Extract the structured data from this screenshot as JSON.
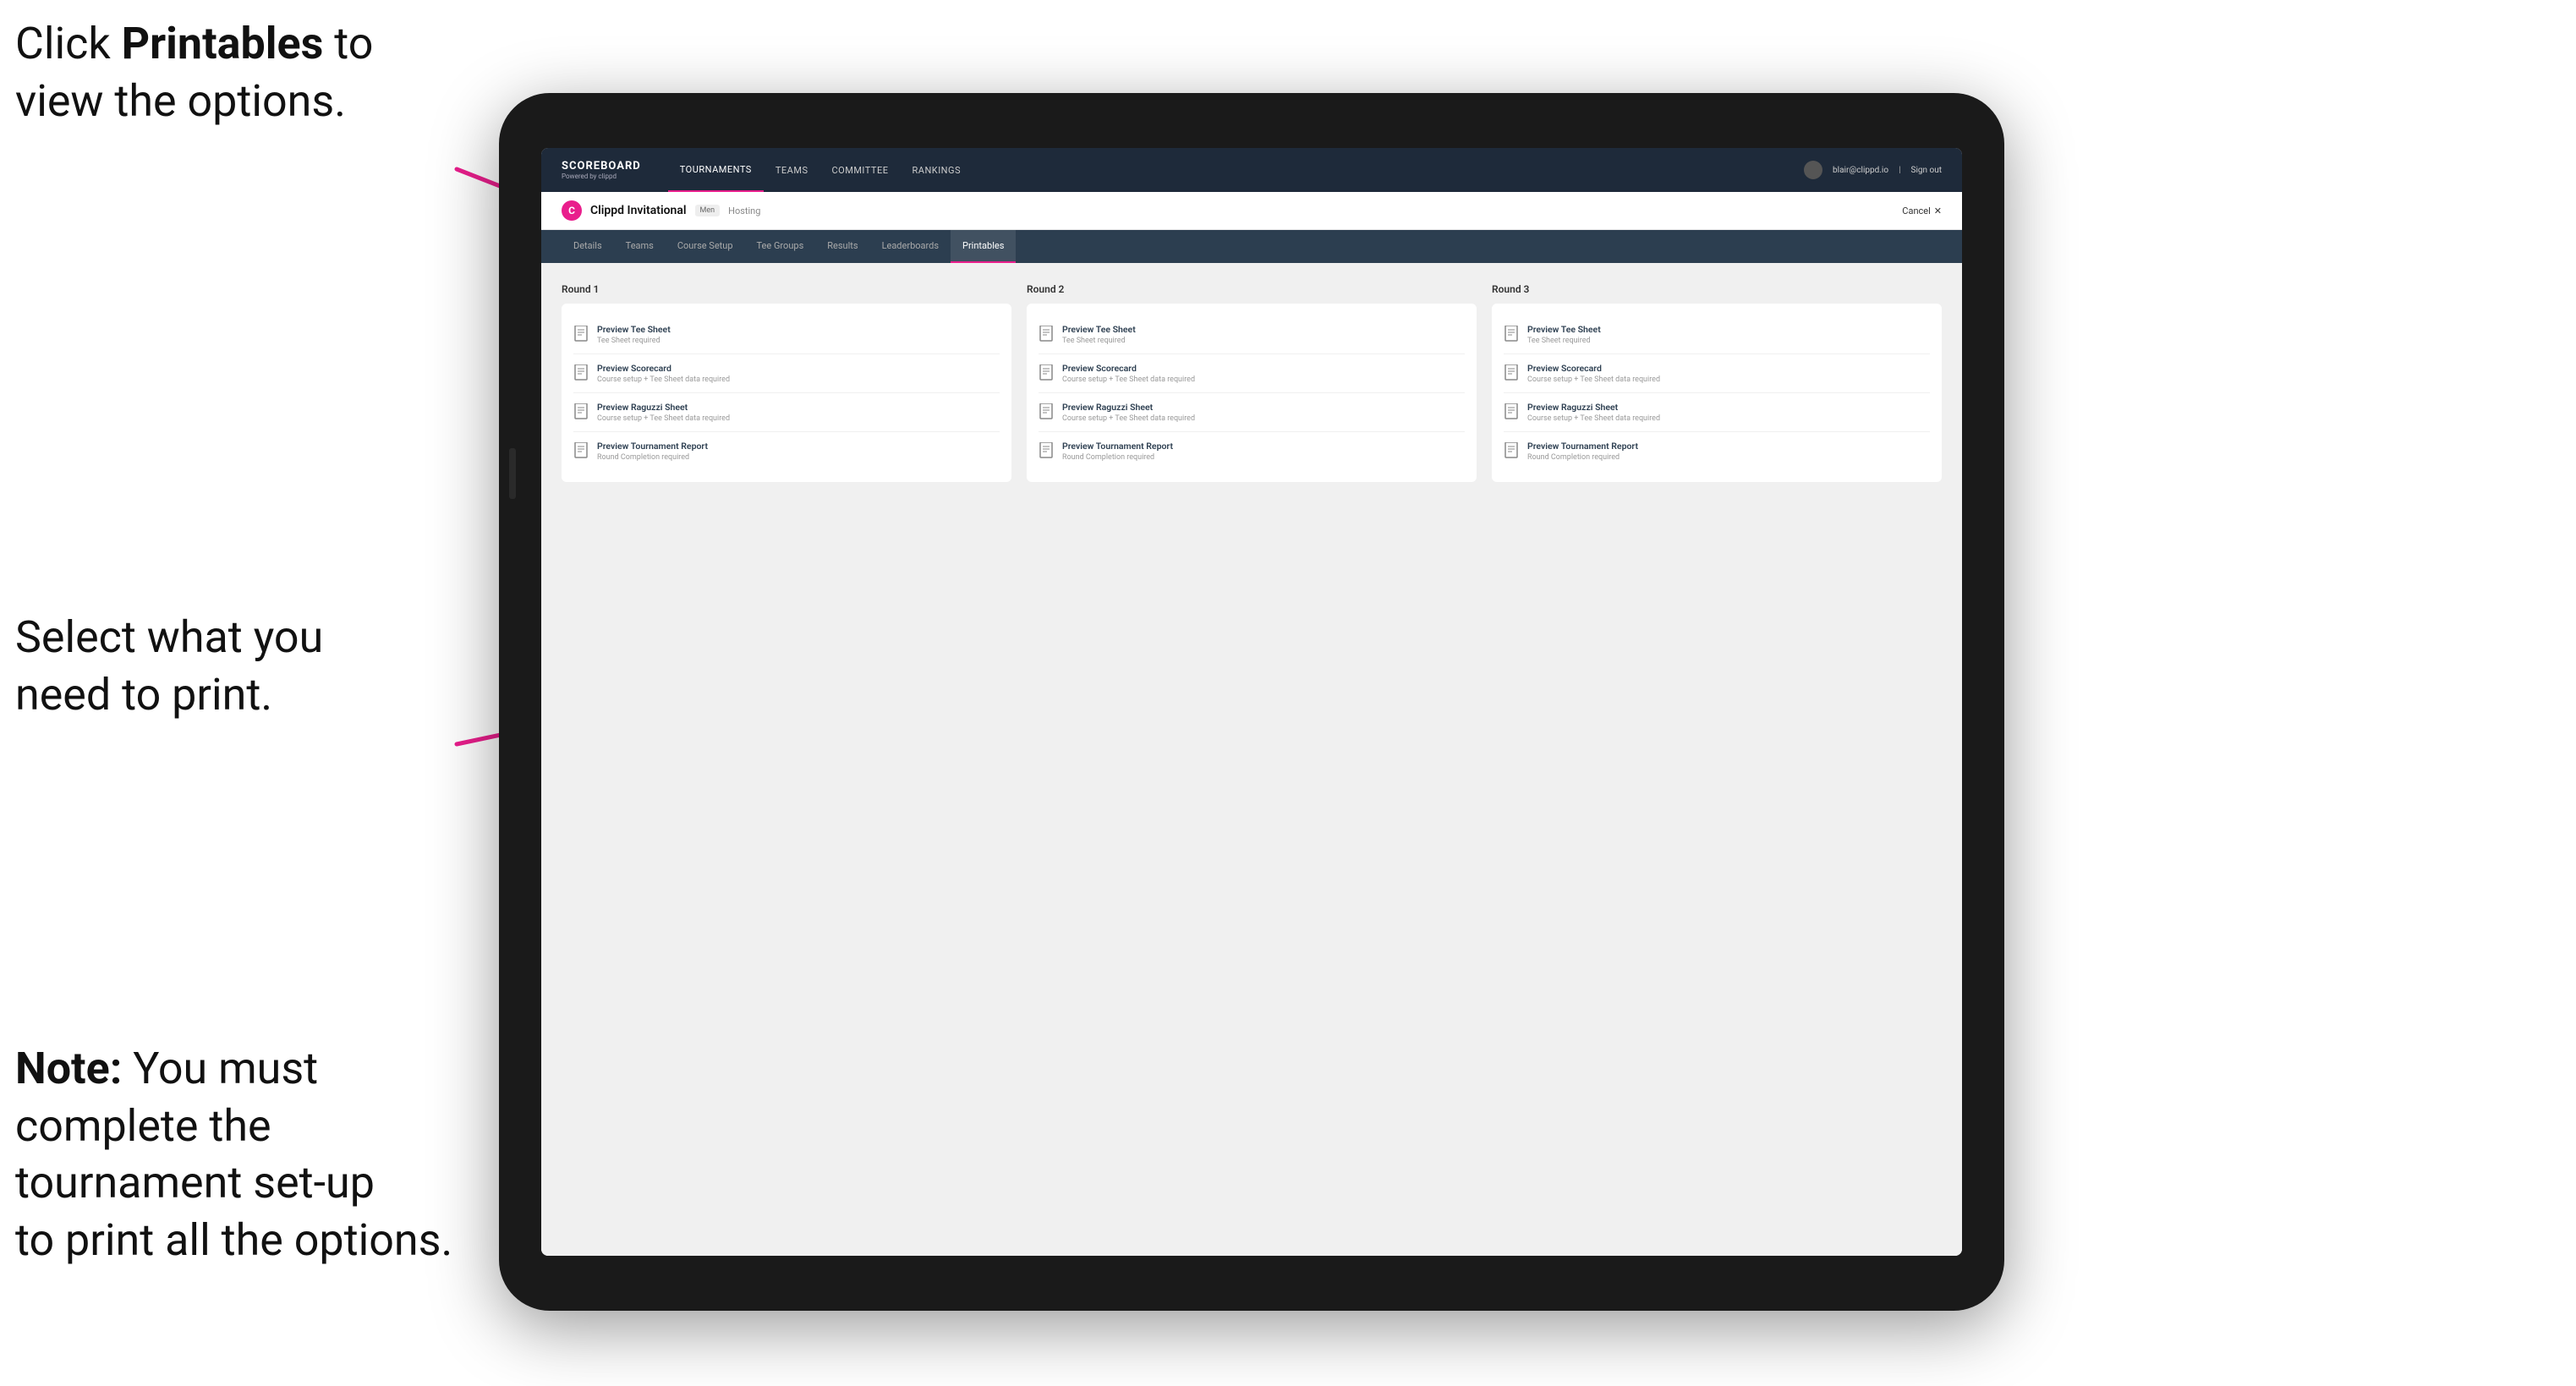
{
  "annotations": {
    "top": {
      "line1": "Click ",
      "bold": "Printables",
      "line2": " to",
      "line3": "view the options."
    },
    "mid": {
      "line1": "Select what you",
      "line2": "need to print."
    },
    "bot": {
      "bold": "Note:",
      "line1": " You must",
      "line2": "complete the",
      "line3": "tournament set-up",
      "line4": "to print all the options."
    }
  },
  "topNav": {
    "logo": "SCOREBOARD",
    "logoSub": "Powered by clippd",
    "links": [
      "TOURNAMENTS",
      "TEAMS",
      "COMMITTEE",
      "RANKINGS"
    ],
    "userEmail": "blair@clippd.io",
    "signOut": "Sign out"
  },
  "tournament": {
    "logo": "C",
    "name": "Clippd Invitational",
    "badge": "Men",
    "hosting": "Hosting",
    "cancel": "Cancel"
  },
  "tabs": [
    "Details",
    "Teams",
    "Course Setup",
    "Tee Groups",
    "Results",
    "Leaderboards",
    "Printables"
  ],
  "activeTab": "Printables",
  "rounds": [
    {
      "title": "Round 1",
      "items": [
        {
          "name": "Preview Tee Sheet",
          "req": "Tee Sheet required"
        },
        {
          "name": "Preview Scorecard",
          "req": "Course setup + Tee Sheet data required"
        },
        {
          "name": "Preview Raguzzi Sheet",
          "req": "Course setup + Tee Sheet data required"
        },
        {
          "name": "Preview Tournament Report",
          "req": "Round Completion required"
        }
      ]
    },
    {
      "title": "Round 2",
      "items": [
        {
          "name": "Preview Tee Sheet",
          "req": "Tee Sheet required"
        },
        {
          "name": "Preview Scorecard",
          "req": "Course setup + Tee Sheet data required"
        },
        {
          "name": "Preview Raguzzi Sheet",
          "req": "Course setup + Tee Sheet data required"
        },
        {
          "name": "Preview Tournament Report",
          "req": "Round Completion required"
        }
      ]
    },
    {
      "title": "Round 3",
      "items": [
        {
          "name": "Preview Tee Sheet",
          "req": "Tee Sheet required"
        },
        {
          "name": "Preview Scorecard",
          "req": "Course setup + Tee Sheet data required"
        },
        {
          "name": "Preview Raguzzi Sheet",
          "req": "Course setup + Tee Sheet data required"
        },
        {
          "name": "Preview Tournament Report",
          "req": "Round Completion required"
        }
      ]
    }
  ]
}
